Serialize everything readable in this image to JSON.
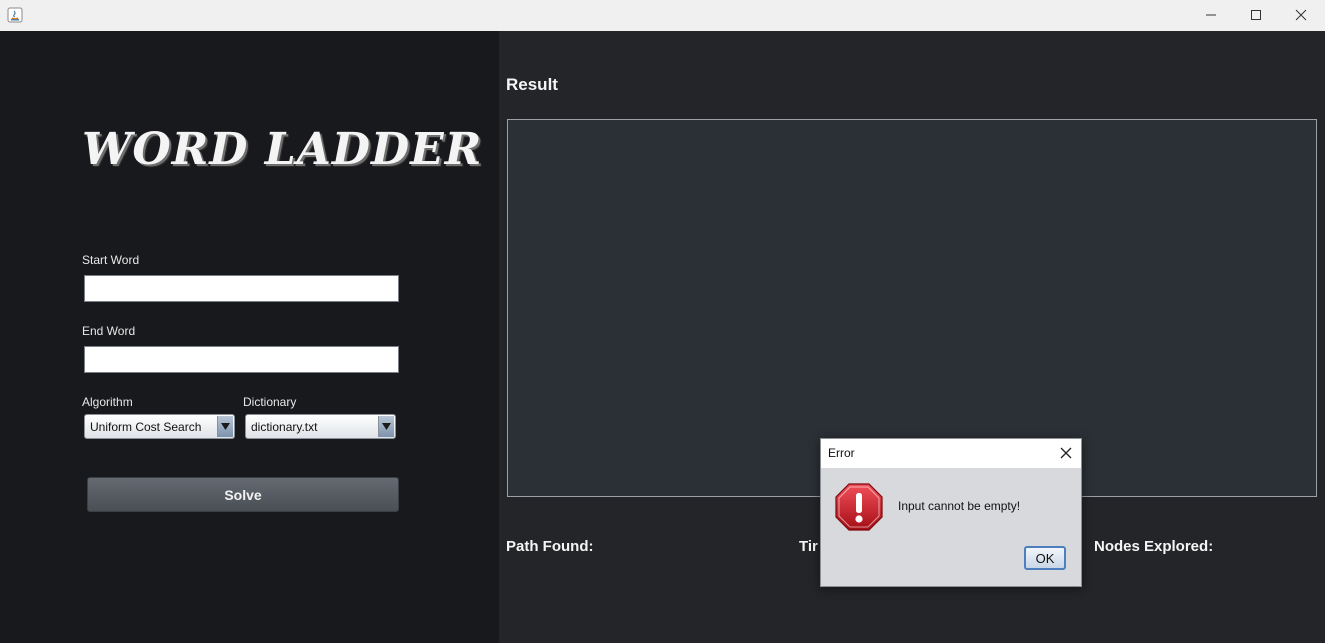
{
  "window": {
    "app_icon": "java-icon",
    "controls": [
      "minimize-icon",
      "maximize-icon",
      "close-icon"
    ]
  },
  "app": {
    "title": "WORD LADDER"
  },
  "form": {
    "start_label": "Start Word",
    "start_value": "",
    "end_label": "End Word",
    "end_value": "",
    "algorithm_label": "Algorithm",
    "algorithm_value": "Uniform Cost Search",
    "dictionary_label": "Dictionary",
    "dictionary_value": "dictionary.txt",
    "solve_label": "Solve"
  },
  "result": {
    "title": "Result",
    "path_found_label": "Path Found:",
    "time_label_visible": "Tir",
    "nodes_explored_label": "Nodes Explored:"
  },
  "dialog": {
    "title": "Error",
    "message": "Input cannot be empty!",
    "ok_label": "OK",
    "icon": "error-stop-icon"
  },
  "colors": {
    "left_bg": "#18191c",
    "right_bg": "#232529",
    "result_bg": "#2b3036",
    "error_red": "#c8161d"
  }
}
